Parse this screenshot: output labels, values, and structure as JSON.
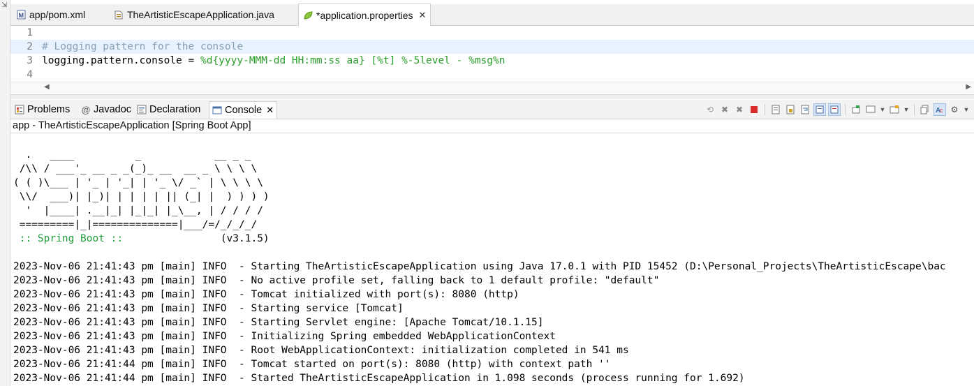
{
  "editor": {
    "tabs": [
      {
        "label": "app/pom.xml",
        "icon": "maven-pom-icon",
        "active": false
      },
      {
        "label": "TheArtisticEscapeApplication.java",
        "icon": "java-file-icon",
        "active": false
      },
      {
        "label": "*application.properties",
        "icon": "spring-leaf-icon",
        "active": true
      }
    ],
    "lines": [
      {
        "number": "1",
        "text": ""
      },
      {
        "number": "2",
        "text": "# Logging pattern for the console"
      },
      {
        "number": "3",
        "key": "logging.pattern.console = ",
        "value": "%d{yyyy-MMM-dd HH:mm:ss aa} [%t] %-5level - %msg%n"
      },
      {
        "number": "4",
        "text": ""
      }
    ]
  },
  "views": {
    "tabs": [
      {
        "label": "Problems",
        "icon": "problems-icon"
      },
      {
        "label": "Javadoc",
        "icon": "javadoc-at-icon"
      },
      {
        "label": "Declaration",
        "icon": "declaration-icon"
      },
      {
        "label": "Console",
        "icon": "console-icon",
        "active": true
      }
    ]
  },
  "console": {
    "title": "app - TheArtisticEscapeApplication [Spring Boot App]",
    "banner": "  .   ____          _            __ _ _\n /\\\\ / ___'_ __ _ _(_)_ __  __ _ \\ \\ \\ \\\n( ( )\\___ | '_ | '_| | '_ \\/ _` | \\ \\ \\ \\\n \\\\/  ___)| |_)| | | | | || (_| |  ) ) ) )\n  '  |____| .__|_| |_|_| |_\\__, | / / / /\n =========|_|==============|___/=/_/_/_/",
    "boot_label": " :: Spring Boot :: ",
    "boot_version": "               (v3.1.5)",
    "logs": [
      "2023-Nov-06 21:41:43 pm [main] INFO  - Starting TheArtisticEscapeApplication using Java 17.0.1 with PID 15452 (D:\\Personal_Projects\\TheArtisticEscape\\bac",
      "2023-Nov-06 21:41:43 pm [main] INFO  - No active profile set, falling back to 1 default profile: \"default\"",
      "2023-Nov-06 21:41:43 pm [main] INFO  - Tomcat initialized with port(s): 8080 (http)",
      "2023-Nov-06 21:41:43 pm [main] INFO  - Starting service [Tomcat]",
      "2023-Nov-06 21:41:43 pm [main] INFO  - Starting Servlet engine: [Apache Tomcat/10.1.15]",
      "2023-Nov-06 21:41:43 pm [main] INFO  - Initializing Spring embedded WebApplicationContext",
      "2023-Nov-06 21:41:43 pm [main] INFO  - Root WebApplicationContext: initialization completed in 541 ms",
      "2023-Nov-06 21:41:44 pm [main] INFO  - Tomcat started on port(s): 8080 (http) with context path ''",
      "2023-Nov-06 21:41:44 pm [main] INFO  - Started TheArtisticEscapeApplication in 1.098 seconds (process running for 1.692)"
    ]
  },
  "colors": {
    "comment": "#8aa0b4",
    "property_value": "#2a9d2a",
    "boot_label": "#1f9d3a",
    "current_line": "#e8f2fe"
  }
}
